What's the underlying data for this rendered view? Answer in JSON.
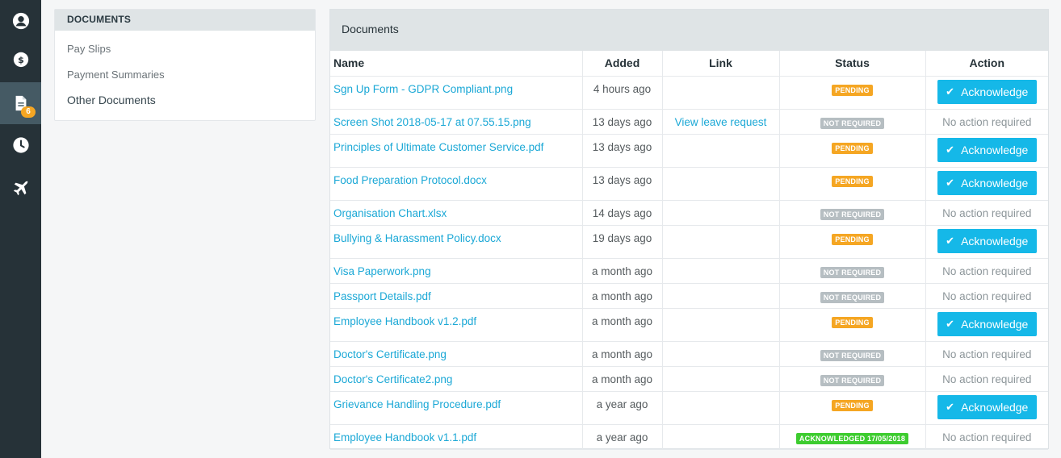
{
  "rail": {
    "badge_count": "6"
  },
  "side": {
    "heading": "DOCUMENTS",
    "links": [
      "Pay Slips",
      "Payment Summaries",
      "Other Documents"
    ]
  },
  "documents": {
    "heading": "Documents",
    "columns": [
      "Name",
      "Added",
      "Link",
      "Status",
      "Action"
    ],
    "rows": [
      {
        "name": "Sgn Up Form - GDPR Compliant.png",
        "added": "4 hours ago",
        "link": "",
        "status": "PENDING",
        "status_kind": "pending",
        "action": "Acknowledge",
        "action_kind": "button"
      },
      {
        "name": "Screen Shot 2018-05-17 at 07.55.15.png",
        "added": "13 days ago",
        "link": "View leave request",
        "status": "NOT REQUIRED",
        "status_kind": "notreq",
        "action": "No action required",
        "action_kind": "text"
      },
      {
        "name": "Principles of Ultimate Customer Service.pdf",
        "added": "13 days ago",
        "link": "",
        "status": "PENDING",
        "status_kind": "pending",
        "action": "Acknowledge",
        "action_kind": "button"
      },
      {
        "name": "Food Preparation Protocol.docx",
        "added": "13 days ago",
        "link": "",
        "status": "PENDING",
        "status_kind": "pending",
        "action": "Acknowledge",
        "action_kind": "button"
      },
      {
        "name": "Organisation Chart.xlsx",
        "added": "14 days ago",
        "link": "",
        "status": "NOT REQUIRED",
        "status_kind": "notreq",
        "action": "No action required",
        "action_kind": "text"
      },
      {
        "name": "Bullying & Harassment Policy.docx",
        "added": "19 days ago",
        "link": "",
        "status": "PENDING",
        "status_kind": "pending",
        "action": "Acknowledge",
        "action_kind": "button"
      },
      {
        "name": "Visa Paperwork.png",
        "added": "a month ago",
        "link": "",
        "status": "NOT REQUIRED",
        "status_kind": "notreq",
        "action": "No action required",
        "action_kind": "text"
      },
      {
        "name": "Passport Details.pdf",
        "added": "a month ago",
        "link": "",
        "status": "NOT REQUIRED",
        "status_kind": "notreq",
        "action": "No action required",
        "action_kind": "text"
      },
      {
        "name": "Employee Handbook v1.2.pdf",
        "added": "a month ago",
        "link": "",
        "status": "PENDING",
        "status_kind": "pending",
        "action": "Acknowledge",
        "action_kind": "button"
      },
      {
        "name": "Doctor's Certificate.png",
        "added": "a month ago",
        "link": "",
        "status": "NOT REQUIRED",
        "status_kind": "notreq",
        "action": "No action required",
        "action_kind": "text"
      },
      {
        "name": "Doctor's Certificate2.png",
        "added": "a month ago",
        "link": "",
        "status": "NOT REQUIRED",
        "status_kind": "notreq",
        "action": "No action required",
        "action_kind": "text"
      },
      {
        "name": "Grievance Handling Procedure.pdf",
        "added": "a year ago",
        "link": "",
        "status": "PENDING",
        "status_kind": "pending",
        "action": "Acknowledge",
        "action_kind": "button"
      },
      {
        "name": "Employee Handbook v1.1.pdf",
        "added": "a year ago",
        "link": "",
        "status": "ACKNOWLEDGED 17/05/2018",
        "status_kind": "ack",
        "action": "No action required",
        "action_kind": "text"
      }
    ]
  },
  "colors": {
    "rail": "#263238",
    "accent": "#15b8e8",
    "pending": "#f5a623",
    "not_required": "#b6bec2",
    "acknowledged": "#3dcc2f"
  }
}
